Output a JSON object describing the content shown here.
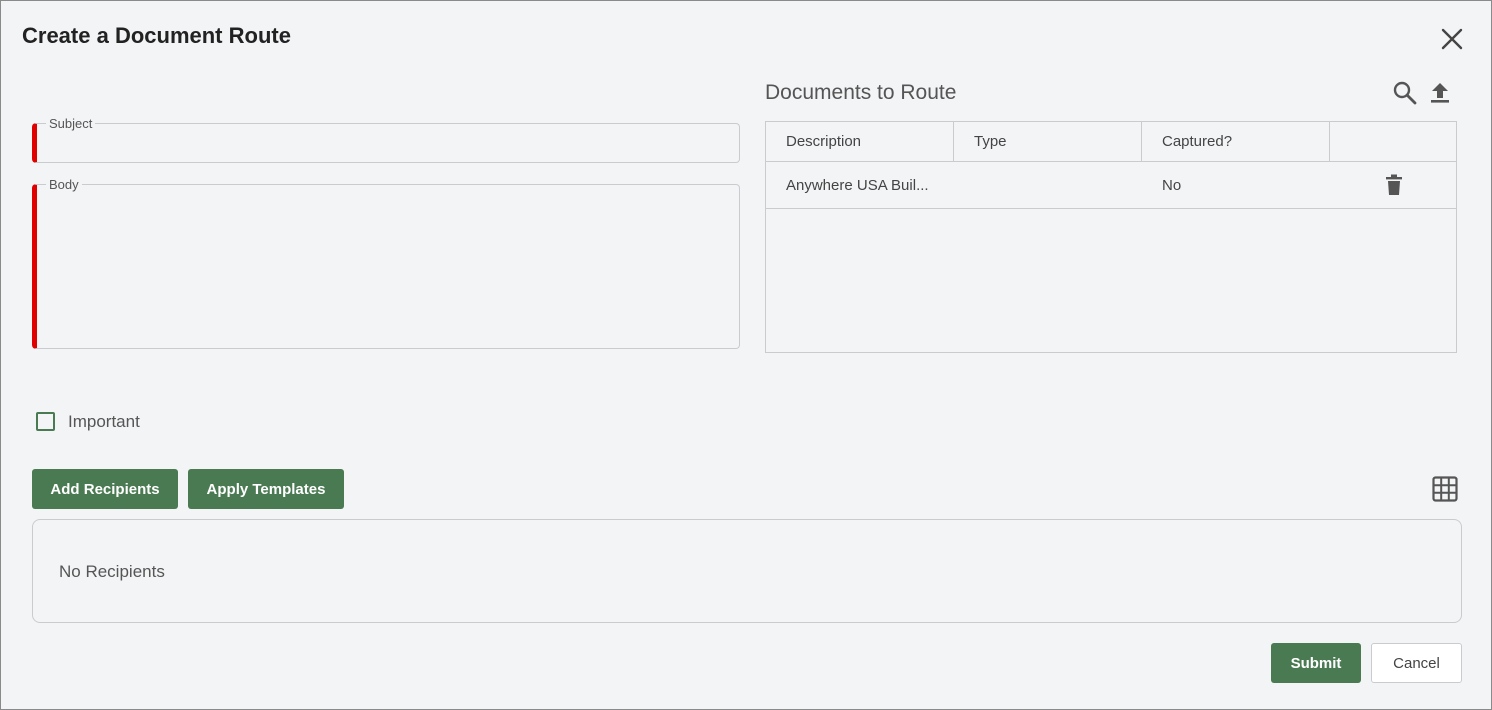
{
  "dialog": {
    "title": "Create a Document Route",
    "close_icon": "close-icon"
  },
  "form": {
    "subject_label": "Subject",
    "subject_value": "",
    "body_label": "Body",
    "body_value": "",
    "required_color": "#e00000"
  },
  "documents": {
    "title": "Documents to Route",
    "icons": [
      "search-icon",
      "upload-icon"
    ],
    "columns": [
      "Description",
      "Type",
      "Captured?",
      ""
    ],
    "rows": [
      {
        "description": "Anywhere USA Buil...",
        "type": "",
        "captured": "No",
        "action_icon": "trash-icon"
      }
    ]
  },
  "important": {
    "label": "Important",
    "checked": false
  },
  "recipients": {
    "add_label": "Add Recipients",
    "templates_label": "Apply Templates",
    "grid_icon": "grid-icon",
    "empty_text": "No Recipients"
  },
  "footer": {
    "submit_label": "Submit",
    "cancel_label": "Cancel"
  },
  "colors": {
    "accent": "#4a7a52",
    "background": "#f3f4f6"
  }
}
